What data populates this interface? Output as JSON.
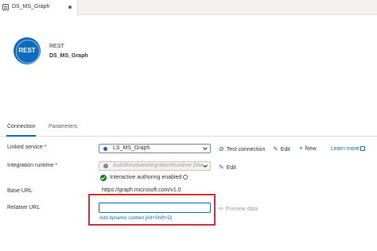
{
  "tab": {
    "label": "DS_MS_Graph"
  },
  "header": {
    "icon_text": "REST",
    "type": "REST",
    "name": "DS_MS_Graph"
  },
  "property_tabs": [
    "Connection",
    "Parameters"
  ],
  "form": {
    "linked_service": {
      "label": "Linked service",
      "required": "*",
      "value": "LS_MS_Graph",
      "actions": {
        "test": "Test connection",
        "edit": "Edit",
        "new": "New",
        "learn_more": "Learn more"
      }
    },
    "integration_runtime": {
      "label": "Integration runtime",
      "required": "*",
      "value": "AutoResolveIntegrationRuntime (Ma...",
      "edit": "Edit",
      "status": "Interactive authoring enabled"
    },
    "base_url": {
      "label": "Base URL",
      "value": "https://graph.microsoft.com/v1.0"
    },
    "relative_url": {
      "label": "Relative URL",
      "value": "",
      "dynamic_content": "Add dynamic content [Alt+Shift+D]",
      "preview": "Preview data"
    }
  },
  "colors": {
    "accent": "#0f6cbd",
    "highlight": "#d13438",
    "success": "#107c10"
  },
  "icons": [
    "document-icon",
    "rest-icon",
    "chevron-down-icon",
    "plug-icon",
    "pencil-icon",
    "plus-icon",
    "external-link-icon",
    "check-circle-icon",
    "info-icon",
    "preview-icon"
  ]
}
